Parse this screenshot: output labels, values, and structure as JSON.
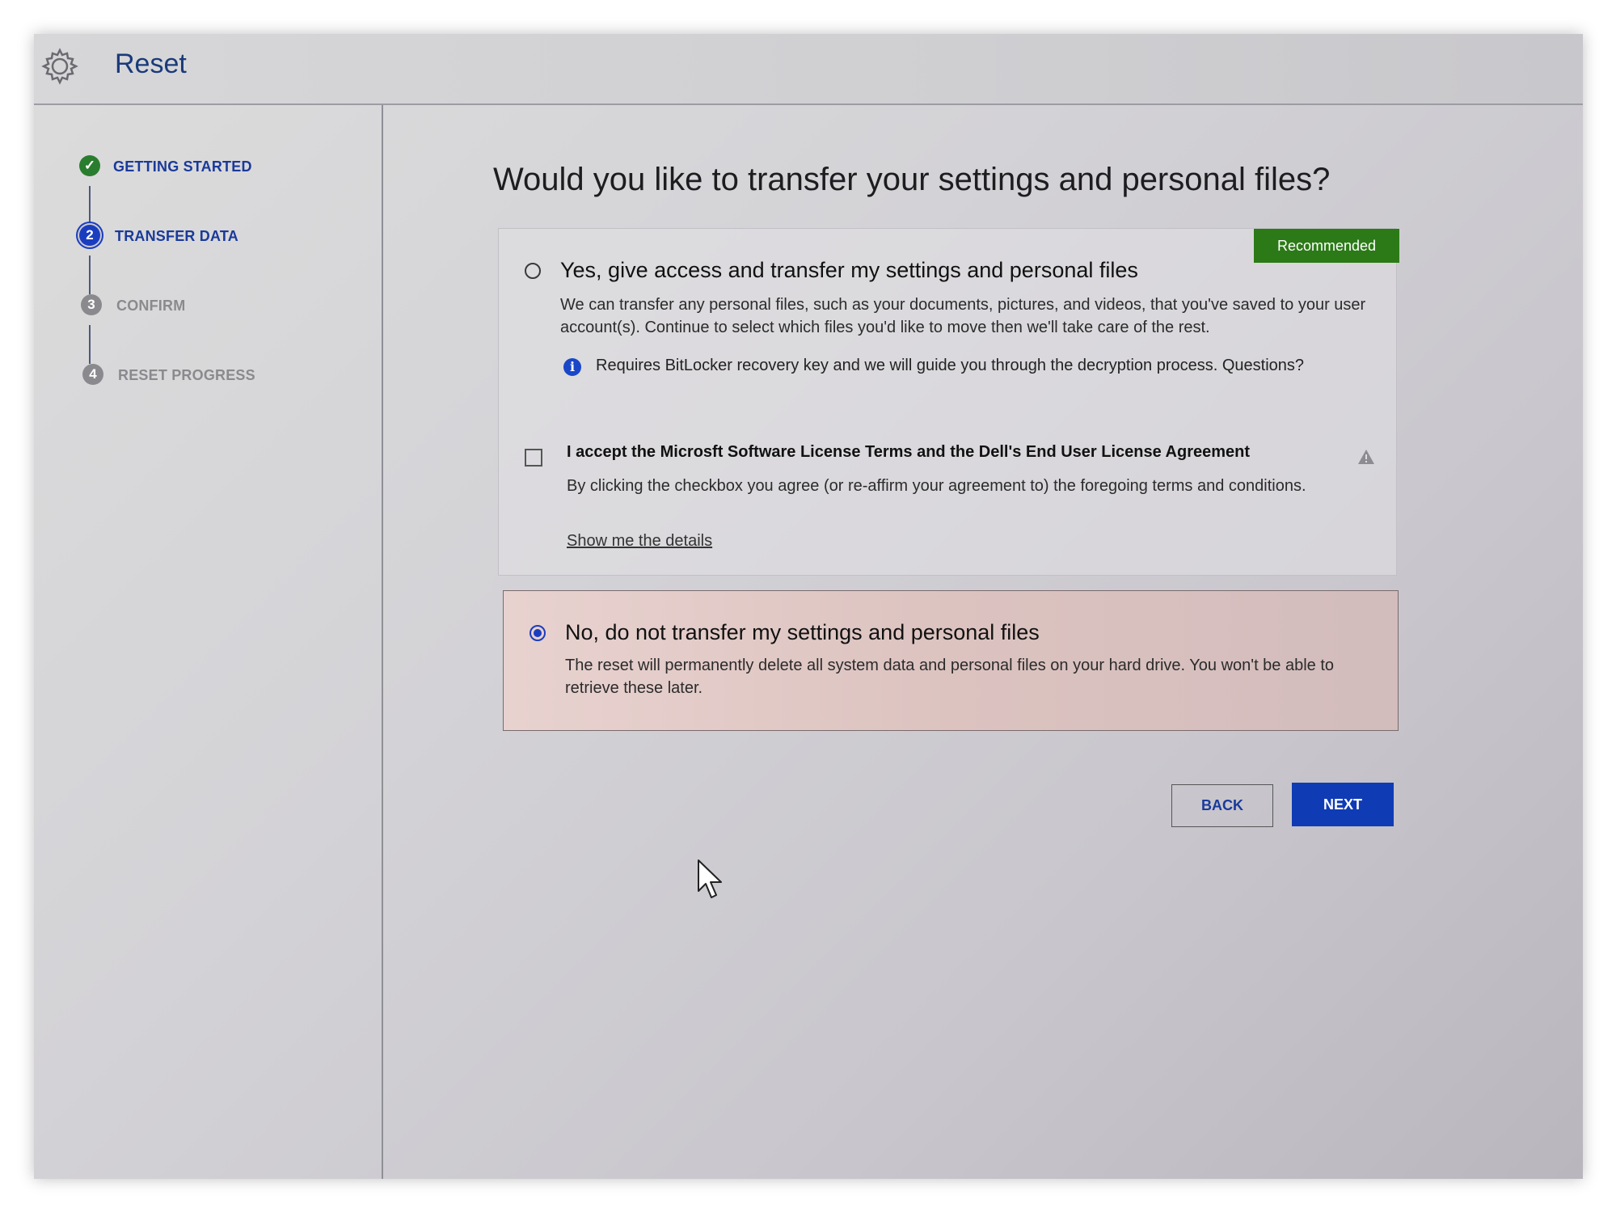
{
  "app": {
    "title": "Reset"
  },
  "steps": [
    {
      "label": "GETTING STARTED",
      "marker": "✓",
      "state": "completed",
      "color": "#2a7d2e"
    },
    {
      "label": "TRANSFER DATA",
      "marker": "2",
      "state": "active",
      "color": "#1a3dc0"
    },
    {
      "label": "CONFIRM",
      "marker": "3",
      "state": "upcoming",
      "color": "#8a8a8e"
    },
    {
      "label": "RESET PROGRESS",
      "marker": "4",
      "state": "upcoming",
      "color": "#8a8a8e"
    }
  ],
  "main": {
    "title": "Would you like to transfer your settings and personal files?"
  },
  "option_yes": {
    "badge": "Recommended",
    "heading": "Yes, give access and transfer my settings and personal files",
    "description": "We can transfer any personal files, such as your documents, pictures, and videos, that you've saved to your user account(s). Continue to select which files you'd like to move then we'll take care of the rest.",
    "info_icon": "i",
    "info_text": "Requires BitLocker recovery key and we will guide you through the decryption process. Questions?",
    "selected": false,
    "eula": {
      "heading": "I accept the Microsft Software License Terms and the Dell's End User License Agreement",
      "description": "By clicking the checkbox you agree (or re-affirm your agreement to) the foregoing terms and conditions.",
      "link": "Show me the details",
      "checked": false
    }
  },
  "option_no": {
    "heading": "No, do not transfer my settings and personal files",
    "description": "The reset will permanently delete all system data and personal files on your hard drive. You won't be able to retrieve these later.",
    "selected": true
  },
  "buttons": {
    "back": "BACK",
    "next": "NEXT"
  },
  "colors": {
    "accent": "#0f3bb5",
    "recommended": "#2c7a17",
    "completed": "#2a7d2e"
  }
}
